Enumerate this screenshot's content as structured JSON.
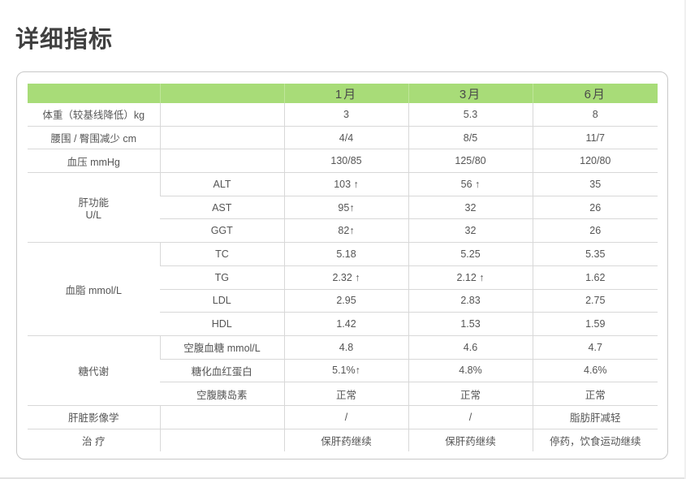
{
  "page_title": "详细指标",
  "table": {
    "months": [
      "1月",
      "3月",
      "6月"
    ],
    "rows": {
      "weight": {
        "label": "体重（较基线降低）kg",
        "values": [
          "3",
          "5.3",
          "8"
        ]
      },
      "waist": {
        "label": "腰围 / 臀围减少 cm",
        "values": [
          "4/4",
          "8/5",
          "11/7"
        ]
      },
      "bp": {
        "label": "血压 mmHg",
        "values": [
          "130/85",
          "125/80",
          "120/80"
        ]
      },
      "liver": {
        "label_line1": "肝功能",
        "label_line2": "U/L",
        "items": [
          {
            "name": "ALT",
            "values": [
              "103 ↑",
              "56 ↑",
              "35"
            ]
          },
          {
            "name": "AST",
            "values": [
              "95↑",
              "32",
              "26"
            ]
          },
          {
            "name": "GGT",
            "values": [
              "82↑",
              "32",
              "26"
            ]
          }
        ]
      },
      "lipid": {
        "label": "血脂 mmol/L",
        "items": [
          {
            "name": "TC",
            "values": [
              "5.18",
              "5.25",
              "5.35"
            ]
          },
          {
            "name": "TG",
            "values": [
              "2.32 ↑",
              "2.12 ↑",
              "1.62"
            ]
          },
          {
            "name": "LDL",
            "values": [
              "2.95",
              "2.83",
              "2.75"
            ]
          },
          {
            "name": "HDL",
            "values": [
              "1.42",
              "1.53",
              "1.59"
            ]
          }
        ]
      },
      "glucose": {
        "label": "糖代谢",
        "items": [
          {
            "name": "空腹血糖 mmol/L",
            "values": [
              "4.8",
              "4.6",
              "4.7"
            ]
          },
          {
            "name": "糖化血红蛋白",
            "values": [
              "5.1%↑",
              "4.8%",
              "4.6%"
            ]
          },
          {
            "name": "空腹胰岛素",
            "values": [
              "正常",
              "正常",
              "正常"
            ]
          }
        ]
      },
      "imaging": {
        "label": "肝脏影像学",
        "values": [
          "/",
          "/",
          "脂肪肝减轻"
        ]
      },
      "treatment": {
        "label": "治 疗",
        "values": [
          "保肝药继续",
          "保肝药继续",
          "停药，饮食运动继续"
        ]
      }
    }
  }
}
